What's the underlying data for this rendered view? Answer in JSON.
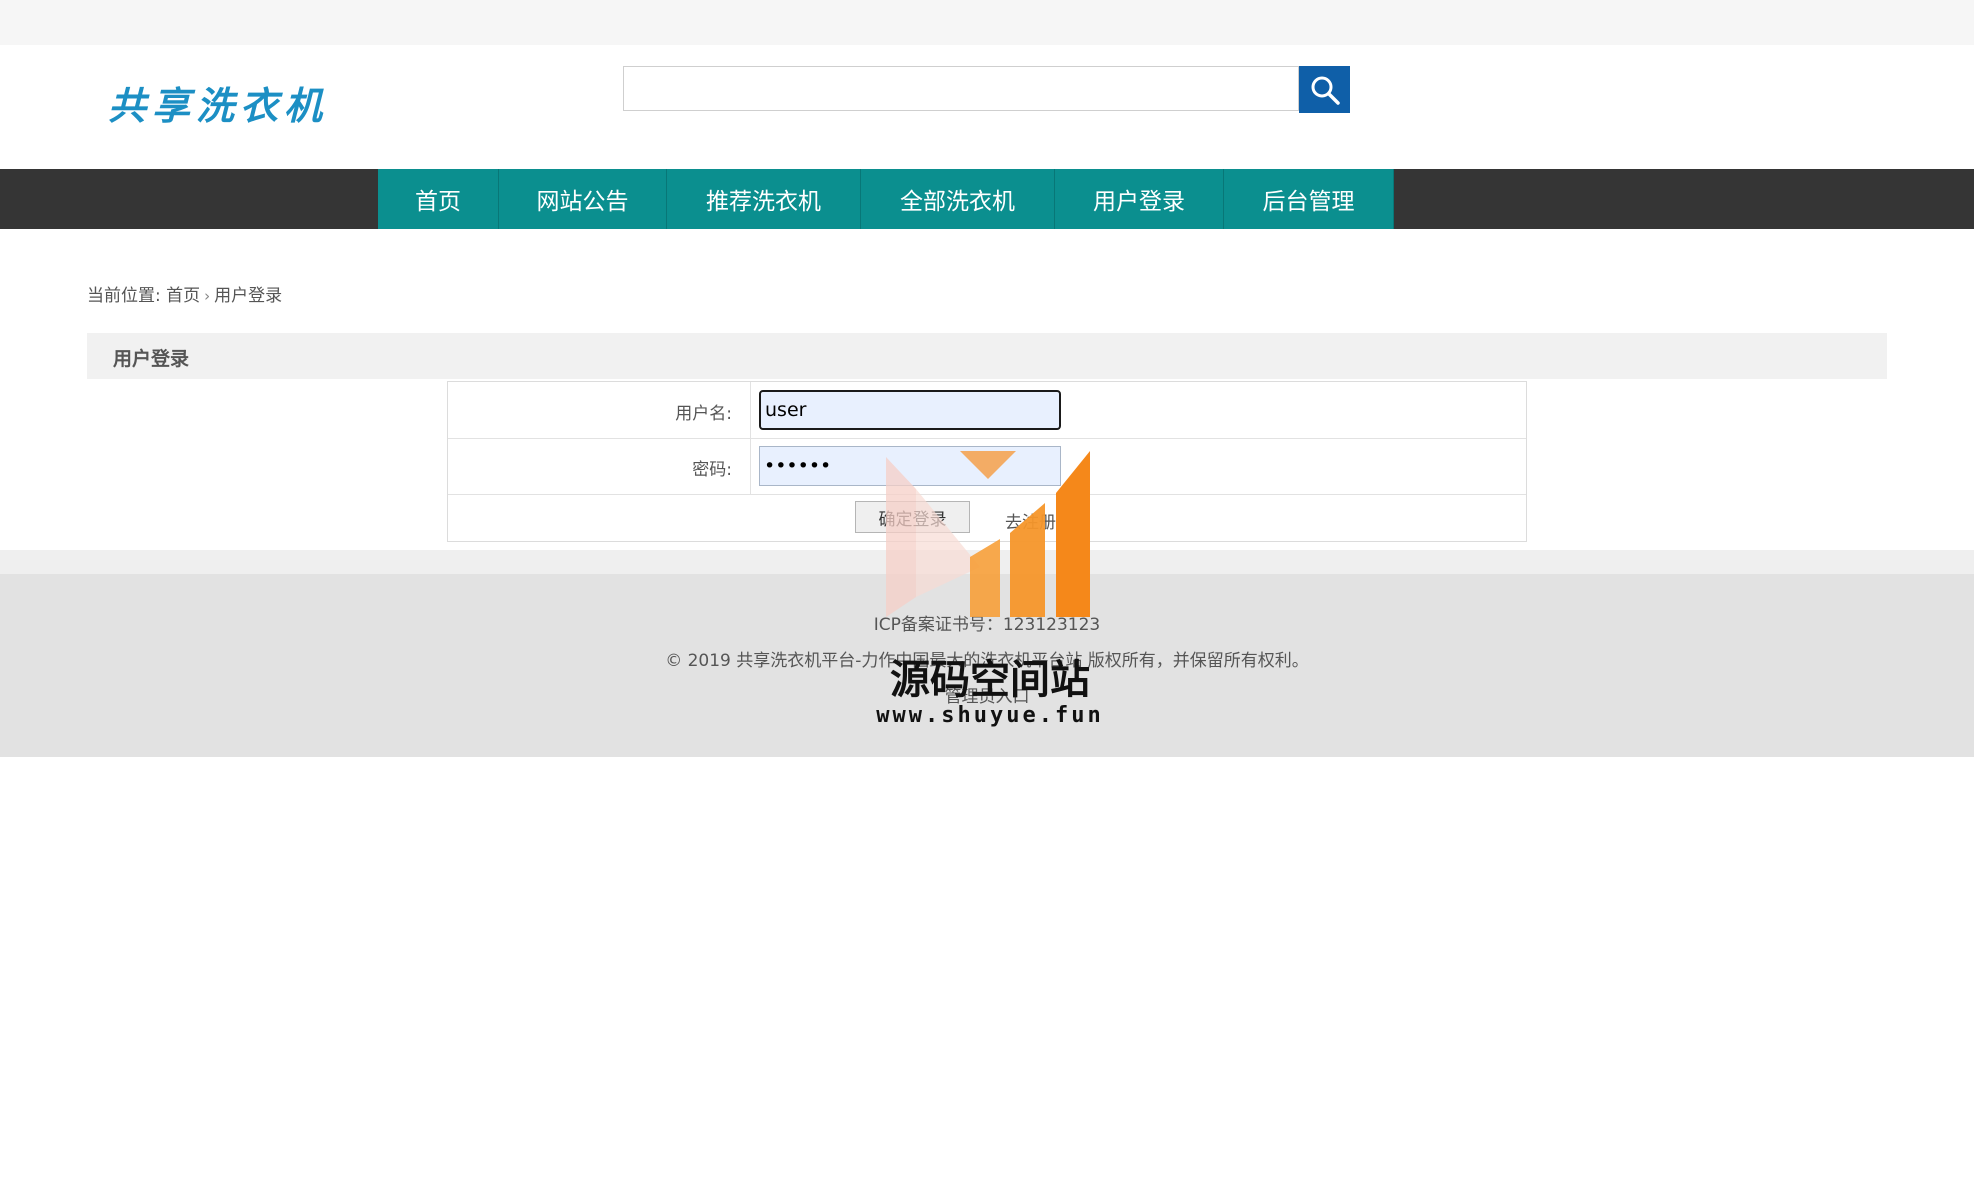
{
  "header": {
    "logo_text": "共享洗衣机",
    "search": {
      "value": "",
      "placeholder": ""
    }
  },
  "nav": {
    "items": [
      {
        "label": "首页"
      },
      {
        "label": "网站公告"
      },
      {
        "label": "推荐洗衣机"
      },
      {
        "label": "全部洗衣机"
      },
      {
        "label": "用户登录"
      },
      {
        "label": "后台管理"
      }
    ]
  },
  "breadcrumb": {
    "prefix": "当前位置:",
    "home": "首页",
    "current": "用户登录"
  },
  "section": {
    "title": "用户登录"
  },
  "form": {
    "username_label": "用户名:",
    "username_value": "user",
    "password_label": "密码:",
    "password_value": "••••••",
    "login_button": "确定登录",
    "register_link": "去注册"
  },
  "footer": {
    "icp": "ICP备案证书号：123123123",
    "copyright": "© 2019 共享洗衣机平台-力作中国最大的洗衣机平台站 版权所有，并保留所有权利。",
    "admin_link": "管理员入口"
  },
  "watermark": {
    "title": "源码空间站",
    "url": "www.shuyue.fun"
  },
  "colors": {
    "nav_bg": "#353535",
    "nav_item_bg": "#0b8f8f",
    "search_button": "#0f5fa8",
    "logo": "#1c8fc4",
    "input_autofill": "#e8f0fe"
  }
}
